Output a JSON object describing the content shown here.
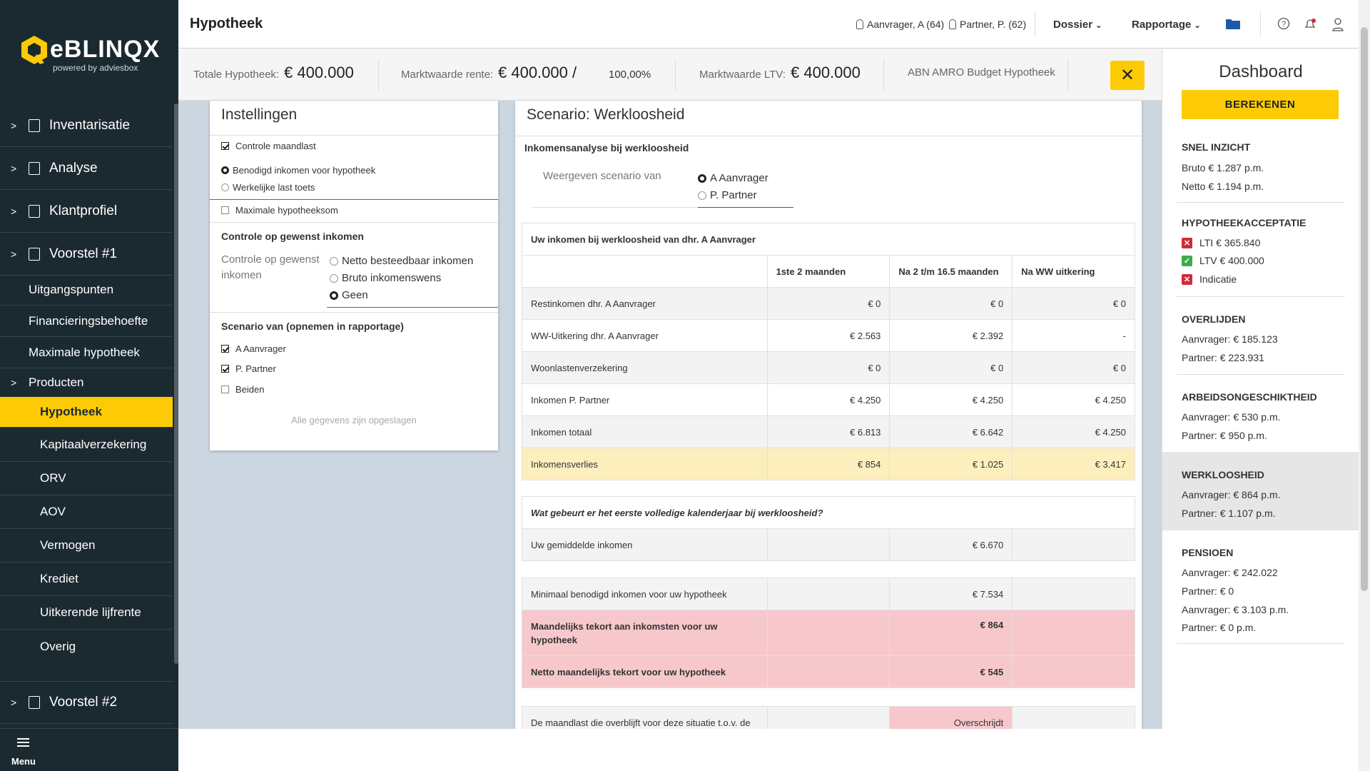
{
  "sidebar": {
    "brand": "eBLINQX",
    "brand_sub": "powered by adviesbox",
    "sections": [
      {
        "label": "Inventarisatie"
      },
      {
        "label": "Analyse"
      },
      {
        "label": "Klantprofiel"
      },
      {
        "label": "Voorstel #1"
      }
    ],
    "subitems": [
      {
        "label": "Uitgangspunten"
      },
      {
        "label": "Financieringsbehoefte"
      },
      {
        "label": "Maximale hypotheek"
      },
      {
        "label": "Producten"
      }
    ],
    "products": [
      {
        "label": "Hypotheek",
        "active": true
      },
      {
        "label": "Kapitaalverzekering"
      },
      {
        "label": "ORV"
      },
      {
        "label": "AOV"
      },
      {
        "label": "Vermogen"
      },
      {
        "label": "Krediet"
      },
      {
        "label": "Uitkerende lijfrente"
      },
      {
        "label": "Overig"
      }
    ],
    "voorstel2": "Voorstel #2",
    "menu_label": "Menu"
  },
  "topbar": {
    "title": "Hypotheek",
    "aanvrager": "Aanvrager, A (64)",
    "partner": "Partner, P. (62)",
    "dossier": "Dossier",
    "rapportage": "Rapportage"
  },
  "infobar": {
    "totale_label": "Totale Hypotheek:",
    "totale_value": "€ 400.000",
    "rente_label": "Marktwaarde rente:",
    "rente_value": "€ 400.000",
    "slash": "/",
    "percent": "100,00%",
    "ltv_label": "Marktwaarde LTV:",
    "ltv_value": "€ 400.000",
    "product": "ABN AMRO Budget Hypotheek",
    "close": "✕"
  },
  "settings": {
    "title": "Instellingen",
    "controle_maandlast": "Controle maandlast",
    "benodigd": "Benodigd inkomen voor hypotheek",
    "werkelijke": "Werkelijke last toets",
    "maximale": "Maximale hypotheeksom",
    "controle_head": "Controle op gewenst inkomen",
    "controle_label": "Controle op gewenst inkomen",
    "netto": "Netto besteedbaar inkomen",
    "bruto": "Bruto inkomenswens",
    "geen": "Geen",
    "scenario_head": "Scenario van (opnemen in rapportage)",
    "a_aanvrager": "A Aanvrager",
    "p_partner": "P. Partner",
    "beiden": "Beiden",
    "saved": "Alle gegevens zijn opgeslagen"
  },
  "scenario": {
    "title": "Scenario: Werkloosheid",
    "subtitle": "Inkomensanalyse bij werkloosheid",
    "weergeven_label": "Weergeven scenario van",
    "opt_a": "A Aanvrager",
    "opt_p": "P. Partner",
    "table1": {
      "title": "Uw inkomen bij werkloosheid van dhr. A Aanvrager",
      "headers": [
        "",
        "1ste 2 maanden",
        "Na 2 t/m 16.5 maanden",
        "Na WW uitkering"
      ],
      "rows": [
        [
          "Restinkomen dhr. A Aanvrager",
          "€ 0",
          "€ 0",
          "€ 0"
        ],
        [
          "WW-Uitkering dhr. A Aanvrager",
          "€ 2.563",
          "€ 2.392",
          "-"
        ],
        [
          "Woonlastenverzekering",
          "€ 0",
          "€ 0",
          "€ 0"
        ],
        [
          "Inkomen P. Partner",
          "€ 4.250",
          "€ 4.250",
          "€ 4.250"
        ],
        [
          "Inkomen totaal",
          "€ 6.813",
          "€ 6.642",
          "€ 4.250"
        ],
        [
          "Inkomensverlies",
          "€ 854",
          "€ 1.025",
          "€ 3.417"
        ]
      ]
    },
    "table2": {
      "title": "Wat gebeurt er het eerste volledige kalenderjaar bij werkloosheid?",
      "avg_label": "Uw gemiddelde inkomen",
      "avg_value": "€ 6.670"
    },
    "table3": {
      "min_label": "Minimaal benodigd inkomen voor uw hypotheek",
      "min_value": "€ 7.534",
      "tekort_label": "Maandelijks tekort aan inkomsten voor uw hypotheek",
      "tekort_value": "€ 864",
      "netto_label": "Netto maandelijks tekort voor uw hypotheek",
      "netto_value": "€ 545"
    },
    "table4": {
      "label": "De maandlast die overblijft voor deze situatie t.o.v. de",
      "value": "Overschrijdt"
    }
  },
  "dashboard": {
    "title": "Dashboard",
    "calc_button": "BEREKENEN",
    "snel_head": "SNEL INZICHT",
    "bruto": "Bruto € 1.287 p.m.",
    "netto": "Netto € 1.194 p.m.",
    "acceptatie_head": "HYPOTHEEKACCEPTATIE",
    "lti": "LTI € 365.840",
    "ltv": "LTV € 400.000",
    "indicatie": "Indicatie",
    "overlijden_head": "OVERLIJDEN",
    "ov_a": "Aanvrager: € 185.123",
    "ov_p": "Partner: € 223.931",
    "ao_head": "ARBEIDSONGESCHIKTHEID",
    "ao_a": "Aanvrager: € 530 p.m.",
    "ao_p": "Partner: € 950 p.m.",
    "ww_head": "WERKLOOSHEID",
    "ww_a": "Aanvrager: € 864 p.m.",
    "ww_p": "Partner: € 1.107 p.m.",
    "pensioen_head": "PENSIOEN",
    "pe_a1": "Aanvrager: € 242.022",
    "pe_p1": "Partner: € 0",
    "pe_a2": "Aanvrager: € 3.103 p.m.",
    "pe_p2": "Partner: € 0 p.m."
  },
  "colors": {
    "accent": "#fccb05",
    "sidebar": "#1b2a30",
    "error": "#d02b3a",
    "ok": "#3eab4f"
  }
}
